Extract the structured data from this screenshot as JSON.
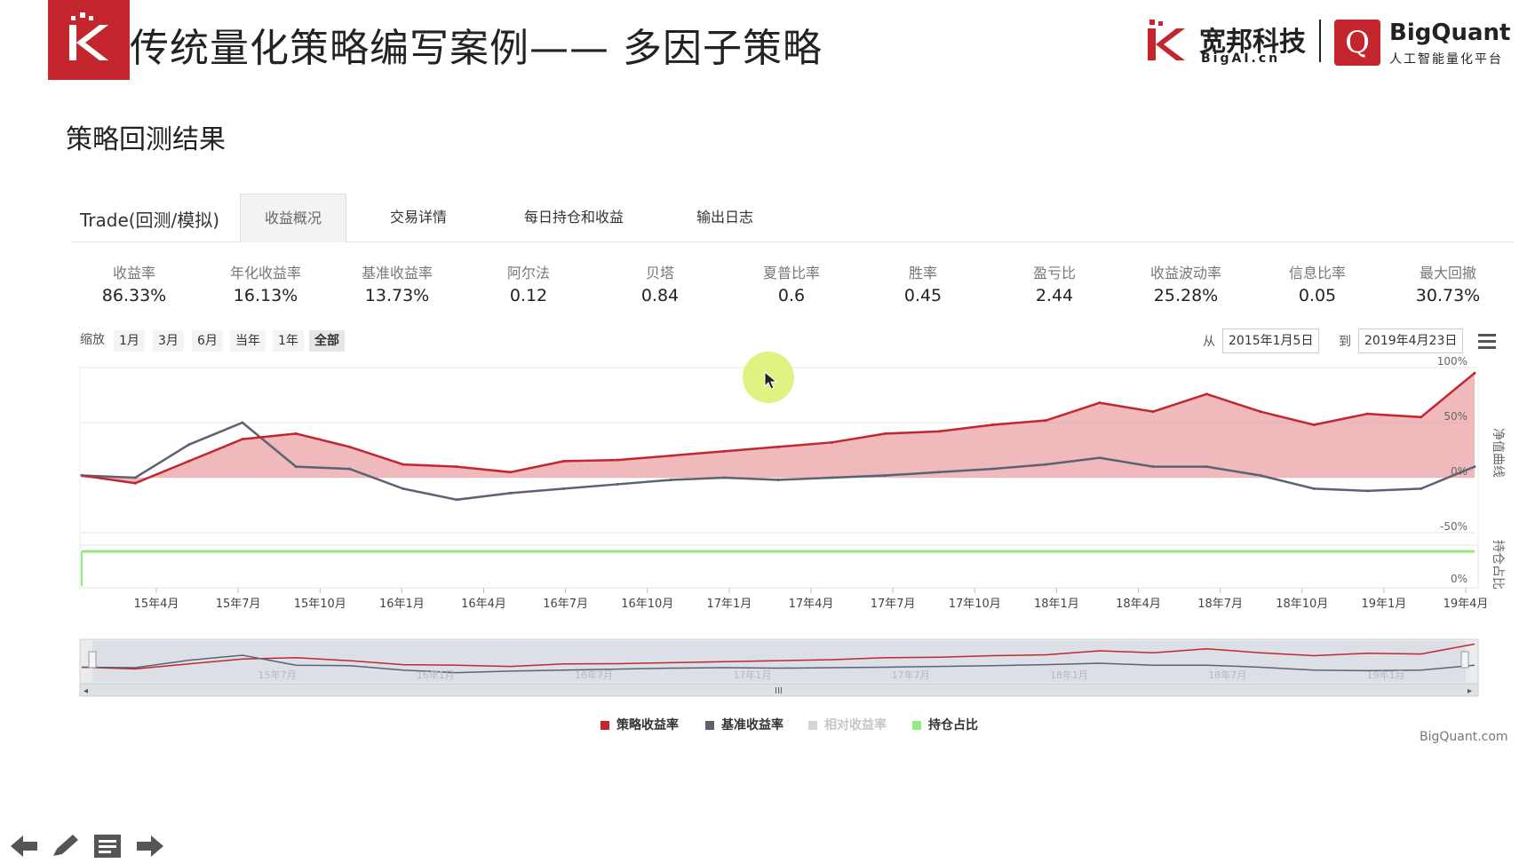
{
  "slide": {
    "title": "传统量化策略编写案例—— 多因子策略",
    "section": "策略回测结果"
  },
  "brand": {
    "cn_name": "宽邦科技",
    "cn_sub": "BigAI.cn",
    "name": "BigQuant",
    "tagline": "人工智能量化平台",
    "credit": "BigQuant.com"
  },
  "tabs": {
    "lead": "Trade(回测/模拟)",
    "items": [
      "收益概况",
      "交易详情",
      "每日持仓和收益",
      "输出日志"
    ],
    "active": 0
  },
  "metrics": [
    {
      "label": "收益率",
      "value": "86.33%"
    },
    {
      "label": "年化收益率",
      "value": "16.13%"
    },
    {
      "label": "基准收益率",
      "value": "13.73%"
    },
    {
      "label": "阿尔法",
      "value": "0.12"
    },
    {
      "label": "贝塔",
      "value": "0.84"
    },
    {
      "label": "夏普比率",
      "value": "0.6"
    },
    {
      "label": "胜率",
      "value": "0.45"
    },
    {
      "label": "盈亏比",
      "value": "2.44"
    },
    {
      "label": "收益波动率",
      "value": "25.28%"
    },
    {
      "label": "信息比率",
      "value": "0.05"
    },
    {
      "label": "最大回撤",
      "value": "30.73%"
    }
  ],
  "zoom": {
    "label": "缩放",
    "buttons": [
      "1月",
      "3月",
      "6月",
      "当年",
      "1年",
      "全部"
    ],
    "selected": "全部",
    "from_label": "从",
    "from": "2015年1月5日",
    "to_label": "到",
    "to": "2019年4月23日"
  },
  "chart_data": {
    "type": "area",
    "y_axis_right_label": "净值曲线",
    "y_axis2_right_label": "持仓占比",
    "yticks": [
      "100%",
      "50%",
      "0%",
      "-50%"
    ],
    "ylim": [
      -0.5,
      1.0
    ],
    "y2ticks": [
      "0%"
    ],
    "xticks": [
      "15年4月",
      "15年7月",
      "15年10月",
      "16年1月",
      "16年4月",
      "16年7月",
      "16年10月",
      "17年1月",
      "17年4月",
      "17年7月",
      "17年10月",
      "18年1月",
      "18年4月",
      "18年7月",
      "18年10月",
      "19年1月",
      "19年4月"
    ],
    "navigator_ticks": [
      "15年7月",
      "16年1月",
      "16年7月",
      "17年1月",
      "17年7月",
      "18年1月",
      "18年7月",
      "19年1月"
    ],
    "x": [
      0,
      2,
      4,
      6,
      8,
      10,
      12,
      14,
      16,
      18,
      20,
      22,
      24,
      26,
      28,
      30,
      32,
      34,
      36,
      38,
      40,
      42,
      44,
      46,
      48,
      50,
      52
    ],
    "series": [
      {
        "name": "策略收益率",
        "color": "#c4262e",
        "values": [
          0.02,
          -0.05,
          0.15,
          0.35,
          0.4,
          0.28,
          0.12,
          0.1,
          0.05,
          0.15,
          0.16,
          0.2,
          0.24,
          0.28,
          0.32,
          0.4,
          0.42,
          0.48,
          0.52,
          0.68,
          0.6,
          0.76,
          0.6,
          0.48,
          0.58,
          0.55,
          0.95
        ]
      },
      {
        "name": "基准收益率",
        "color": "#5b6372",
        "values": [
          0.02,
          0.0,
          0.3,
          0.5,
          0.1,
          0.08,
          -0.1,
          -0.2,
          -0.14,
          -0.1,
          -0.06,
          -0.02,
          0.0,
          -0.02,
          0.0,
          0.02,
          0.05,
          0.08,
          0.12,
          0.18,
          0.1,
          0.1,
          0.02,
          -0.1,
          -0.12,
          -0.1,
          0.1
        ]
      },
      {
        "name": "相对收益率",
        "color": "#c9c9cf",
        "values": []
      },
      {
        "name": "持仓占比",
        "color": "#90ed7d",
        "values": []
      }
    ],
    "legend_position": "bottom-center"
  }
}
